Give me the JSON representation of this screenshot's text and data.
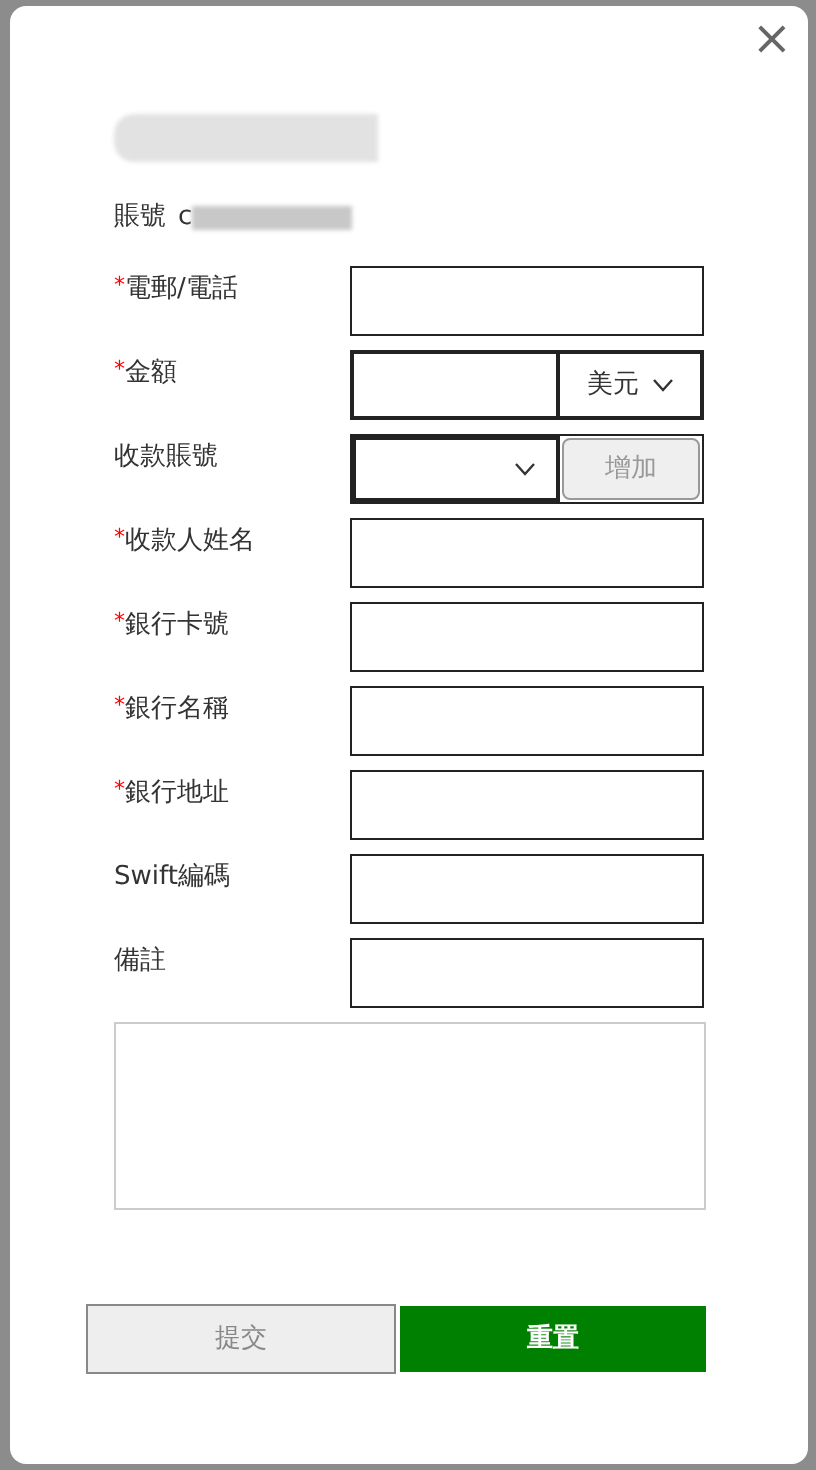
{
  "dialog": {
    "close": "×",
    "account": {
      "label": "賬號",
      "value": "c"
    },
    "fields": [
      {
        "kind": "text",
        "label": "電郵/電話",
        "required_mark": "*"
      },
      {
        "kind": "amount",
        "label": "金額",
        "required_mark": "*",
        "currency": "美元"
      },
      {
        "kind": "select",
        "label": "收款賬號",
        "button": "增加"
      },
      {
        "kind": "text",
        "label": "收款人姓名",
        "required_mark": "*"
      },
      {
        "kind": "text",
        "label": "銀行卡號",
        "required_mark": "*"
      },
      {
        "kind": "text",
        "label": "銀行名稱",
        "required_mark": "*"
      },
      {
        "kind": "text",
        "label": "銀行地址",
        "required_mark": "*"
      },
      {
        "kind": "text",
        "label": "Swift編碼"
      },
      {
        "kind": "text",
        "label": "備註"
      }
    ],
    "buttons": [
      {
        "label": "提交",
        "disabled": true
      },
      {
        "label": "重置",
        "disabled": false
      }
    ]
  }
}
